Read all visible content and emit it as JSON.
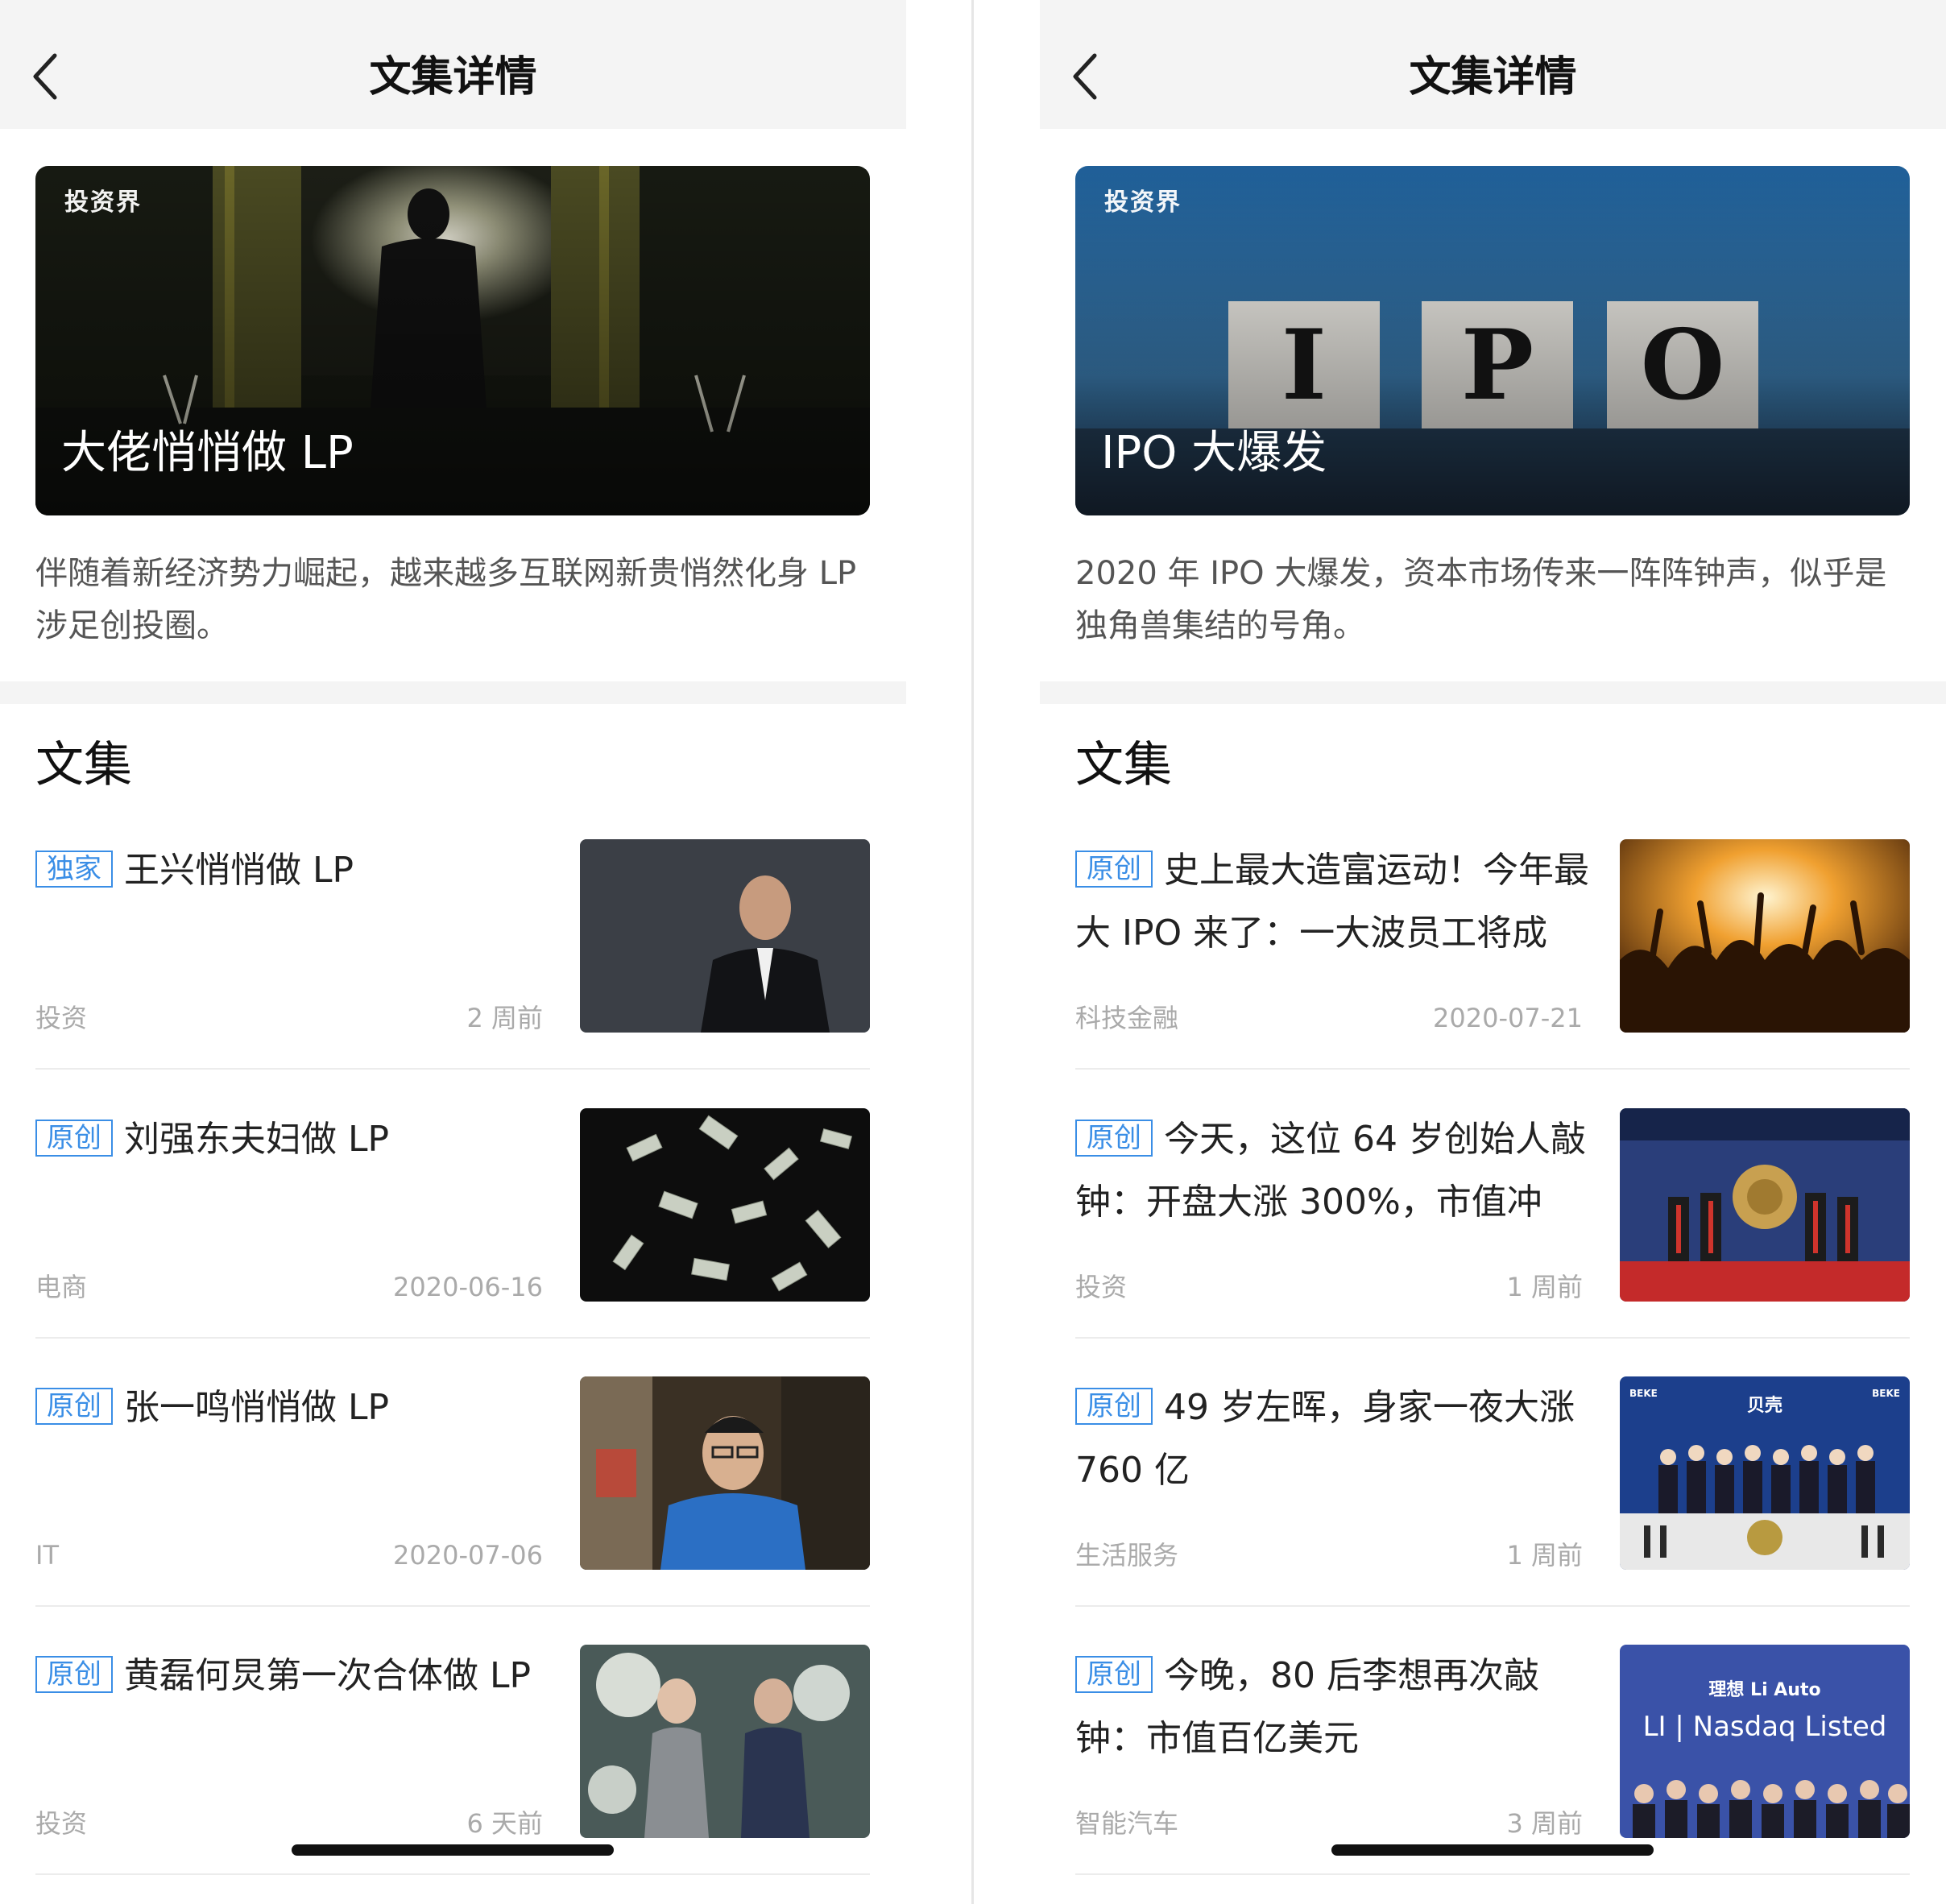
{
  "left": {
    "nav": {
      "title": "文集详情"
    },
    "cover": {
      "title": "大佬悄悄做 LP",
      "brand": "投资界"
    },
    "description": "伴随着新经济势力崛起，越来越多互联网新贵悄然化身 LP 涉足创投圈。",
    "section_title": "文集",
    "articles": [
      {
        "tag": "独家",
        "title": "王兴悄悄做 LP",
        "category": "投资",
        "time": "2 周前",
        "thumb_icon": "portrait-photo"
      },
      {
        "tag": "原创",
        "title": "刘强东夫妇做 LP",
        "category": "电商",
        "time": "2020-06-16",
        "thumb_icon": "flying-money-photo"
      },
      {
        "tag": "原创",
        "title": "张一鸣悄悄做 LP",
        "category": "IT",
        "time": "2020-07-06",
        "thumb_icon": "portrait-photo"
      },
      {
        "tag": "原创",
        "title": "黄磊何炅第一次合体做 LP",
        "category": "投资",
        "time": "6 天前",
        "thumb_icon": "two-people-photo"
      }
    ]
  },
  "right": {
    "nav": {
      "title": "文集详情"
    },
    "cover": {
      "title": "IPO 大爆发",
      "brand": "投资界",
      "letters": [
        "I",
        "P",
        "O"
      ]
    },
    "description": "2020 年 IPO 大爆发，资本市场传来一阵阵钟声，似乎是独角兽集结的号角。",
    "section_title": "文集",
    "articles": [
      {
        "tag": "原创",
        "title": "史上最大造富运动！今年最大 IPO 来了：一大波员工将成",
        "category": "科技金融",
        "time": "2020-07-21",
        "thumb_icon": "crowd-concert-photo"
      },
      {
        "tag": "原创",
        "title": "今天，这位 64 岁创始人敲钟：开盘大涨 300%，市值冲",
        "category": "投资",
        "time": "1 周前",
        "thumb_icon": "bell-ringing-photo"
      },
      {
        "tag": "原创",
        "title": "49 岁左晖，身家一夜大涨 760 亿",
        "category": "生活服务",
        "time": "1 周前",
        "thumb_icon": "nyse-listing-photo",
        "thumb_text": {
          "logo": "贝壳",
          "left": "BEKE",
          "right": "BEKE"
        }
      },
      {
        "tag": "原创",
        "title": "今晚，80 后李想再次敲钟：市值百亿美元",
        "category": "智能汽车",
        "time": "3 周前",
        "thumb_icon": "nasdaq-listing-photo",
        "thumb_text": {
          "brand": "理想 Li Auto",
          "exchange": "LI | Nasdaq Listed"
        }
      }
    ]
  }
}
